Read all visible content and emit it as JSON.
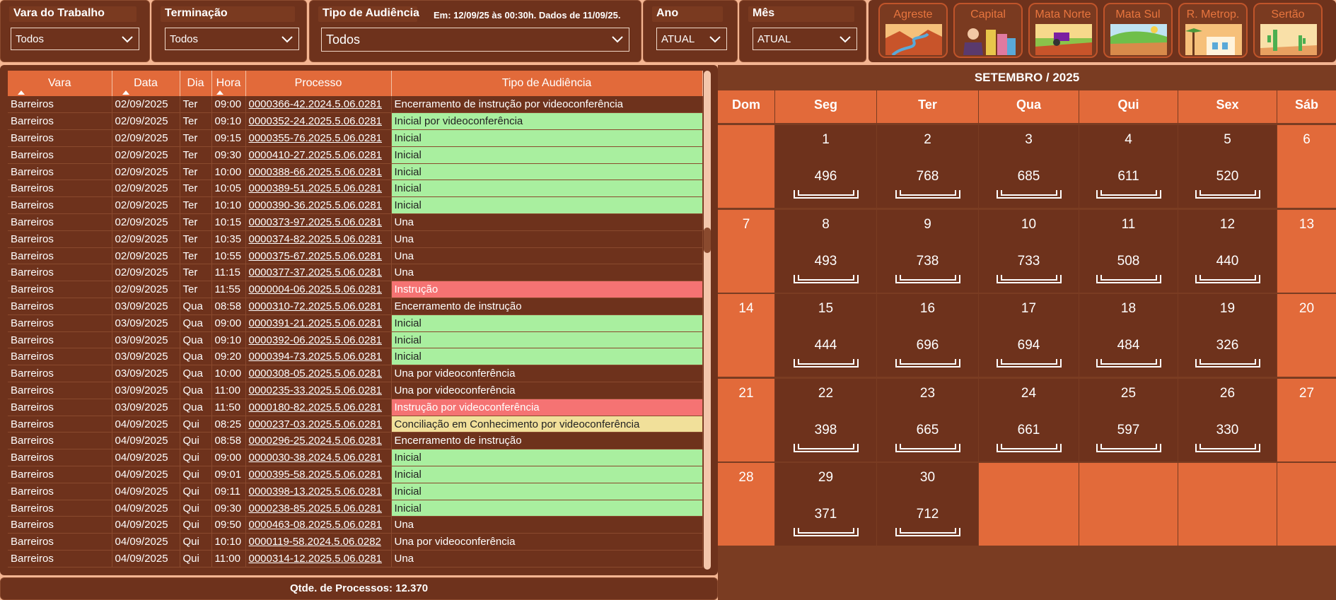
{
  "filters": {
    "vara": {
      "label": "Vara do Trabalho",
      "value": "Todos"
    },
    "terminacao": {
      "label": "Terminação",
      "value": "Todos"
    },
    "tipo": {
      "label": "Tipo de Audiência",
      "value": "Todos"
    },
    "ano": {
      "label": "Ano",
      "value": "ATUAL"
    },
    "mes": {
      "label": "Mês",
      "value": "ATUAL"
    },
    "update_note": "Em: 12/09/25 às 00:30h. Dados de 11/09/25."
  },
  "regions": [
    "Agreste",
    "Capital",
    "Mata Norte",
    "Mata Sul",
    "R. Metrop.",
    "Sertão"
  ],
  "table": {
    "headers": [
      "Vara",
      "Data",
      "Dia",
      "Hora",
      "Processo",
      "Tipo de Audiência"
    ],
    "rows": [
      [
        "Barreiros",
        "02/09/2025",
        "Ter",
        "09:00",
        "0000366-42.2024.5.06.0281",
        "Encerramento de instrução por videoconferência",
        ""
      ],
      [
        "Barreiros",
        "02/09/2025",
        "Ter",
        "09:10",
        "0000352-24.2025.5.06.0281",
        "Inicial por videoconferência",
        "green"
      ],
      [
        "Barreiros",
        "02/09/2025",
        "Ter",
        "09:15",
        "0000355-76.2025.5.06.0281",
        "Inicial",
        "green"
      ],
      [
        "Barreiros",
        "02/09/2025",
        "Ter",
        "09:30",
        "0000410-27.2025.5.06.0281",
        "Inicial",
        "green"
      ],
      [
        "Barreiros",
        "02/09/2025",
        "Ter",
        "10:00",
        "0000388-66.2025.5.06.0281",
        "Inicial",
        "green"
      ],
      [
        "Barreiros",
        "02/09/2025",
        "Ter",
        "10:05",
        "0000389-51.2025.5.06.0281",
        "Inicial",
        "green"
      ],
      [
        "Barreiros",
        "02/09/2025",
        "Ter",
        "10:10",
        "0000390-36.2025.5.06.0281",
        "Inicial",
        "green"
      ],
      [
        "Barreiros",
        "02/09/2025",
        "Ter",
        "10:15",
        "0000373-97.2025.5.06.0281",
        "Una",
        ""
      ],
      [
        "Barreiros",
        "02/09/2025",
        "Ter",
        "10:35",
        "0000374-82.2025.5.06.0281",
        "Una",
        ""
      ],
      [
        "Barreiros",
        "02/09/2025",
        "Ter",
        "10:55",
        "0000375-67.2025.5.06.0281",
        "Una",
        ""
      ],
      [
        "Barreiros",
        "02/09/2025",
        "Ter",
        "11:15",
        "0000377-37.2025.5.06.0281",
        "Una",
        ""
      ],
      [
        "Barreiros",
        "02/09/2025",
        "Ter",
        "11:55",
        "0000004-06.2025.5.06.0281",
        "Instrução",
        "red"
      ],
      [
        "Barreiros",
        "03/09/2025",
        "Qua",
        "08:58",
        "0000310-72.2025.5.06.0281",
        "Encerramento de instrução",
        ""
      ],
      [
        "Barreiros",
        "03/09/2025",
        "Qua",
        "09:00",
        "0000391-21.2025.5.06.0281",
        "Inicial",
        "green"
      ],
      [
        "Barreiros",
        "03/09/2025",
        "Qua",
        "09:10",
        "0000392-06.2025.5.06.0281",
        "Inicial",
        "green"
      ],
      [
        "Barreiros",
        "03/09/2025",
        "Qua",
        "09:20",
        "0000394-73.2025.5.06.0281",
        "Inicial",
        "green"
      ],
      [
        "Barreiros",
        "03/09/2025",
        "Qua",
        "10:00",
        "0000308-05.2025.5.06.0281",
        "Una por videoconferência",
        ""
      ],
      [
        "Barreiros",
        "03/09/2025",
        "Qua",
        "11:00",
        "0000235-33.2025.5.06.0281",
        "Una por videoconferência",
        ""
      ],
      [
        "Barreiros",
        "03/09/2025",
        "Qua",
        "11:50",
        "0000180-82.2025.5.06.0281",
        "Instrução por videoconferência",
        "red"
      ],
      [
        "Barreiros",
        "04/09/2025",
        "Qui",
        "08:25",
        "0000237-03.2025.5.06.0281",
        "Conciliação em Conhecimento por videoconferência",
        "yellow"
      ],
      [
        "Barreiros",
        "04/09/2025",
        "Qui",
        "08:58",
        "0000296-25.2024.5.06.0281",
        "Encerramento de instrução",
        ""
      ],
      [
        "Barreiros",
        "04/09/2025",
        "Qui",
        "09:00",
        "0000030-38.2024.5.06.0281",
        "Inicial",
        "green"
      ],
      [
        "Barreiros",
        "04/09/2025",
        "Qui",
        "09:01",
        "0000395-58.2025.5.06.0281",
        "Inicial",
        "green"
      ],
      [
        "Barreiros",
        "04/09/2025",
        "Qui",
        "09:11",
        "0000398-13.2025.5.06.0281",
        "Inicial",
        "green"
      ],
      [
        "Barreiros",
        "04/09/2025",
        "Qui",
        "09:30",
        "0000238-85.2025.5.06.0281",
        "Inicial",
        "green"
      ],
      [
        "Barreiros",
        "04/09/2025",
        "Qui",
        "09:50",
        "0000463-08.2025.5.06.0281",
        "Una",
        ""
      ],
      [
        "Barreiros",
        "04/09/2025",
        "Qui",
        "10:10",
        "0000119-58.2024.5.06.0282",
        "Una por videoconferência",
        ""
      ],
      [
        "Barreiros",
        "04/09/2025",
        "Qui",
        "11:00",
        "0000314-12.2025.5.06.0281",
        "Una",
        ""
      ]
    ]
  },
  "footer": "Qtde. de Processos: 12.370",
  "calendar": {
    "title": "SETEMBRO / 2025",
    "weekdays": [
      "Dom",
      "Seg",
      "Ter",
      "Qua",
      "Qui",
      "Sex",
      "Sáb"
    ],
    "weeks": [
      [
        [
          "",
          ""
        ],
        [
          "1",
          "496"
        ],
        [
          "2",
          "768"
        ],
        [
          "3",
          "685"
        ],
        [
          "4",
          "611"
        ],
        [
          "5",
          "520"
        ],
        [
          "6",
          ""
        ]
      ],
      [
        [
          "7",
          ""
        ],
        [
          "8",
          "493"
        ],
        [
          "9",
          "738"
        ],
        [
          "10",
          "733"
        ],
        [
          "11",
          "508"
        ],
        [
          "12",
          "440"
        ],
        [
          "13",
          ""
        ]
      ],
      [
        [
          "14",
          ""
        ],
        [
          "15",
          "444"
        ],
        [
          "16",
          "696"
        ],
        [
          "17",
          "694"
        ],
        [
          "18",
          "484"
        ],
        [
          "19",
          "326"
        ],
        [
          "20",
          ""
        ]
      ],
      [
        [
          "21",
          ""
        ],
        [
          "22",
          "398"
        ],
        [
          "23",
          "665"
        ],
        [
          "24",
          "661"
        ],
        [
          "25",
          "597"
        ],
        [
          "26",
          "330"
        ],
        [
          "27",
          ""
        ]
      ],
      [
        [
          "28",
          ""
        ],
        [
          "29",
          "371"
        ],
        [
          "30",
          "712"
        ],
        [
          "",
          ""
        ],
        [
          "",
          ""
        ],
        [
          "",
          ""
        ],
        [
          "",
          ""
        ]
      ]
    ]
  }
}
